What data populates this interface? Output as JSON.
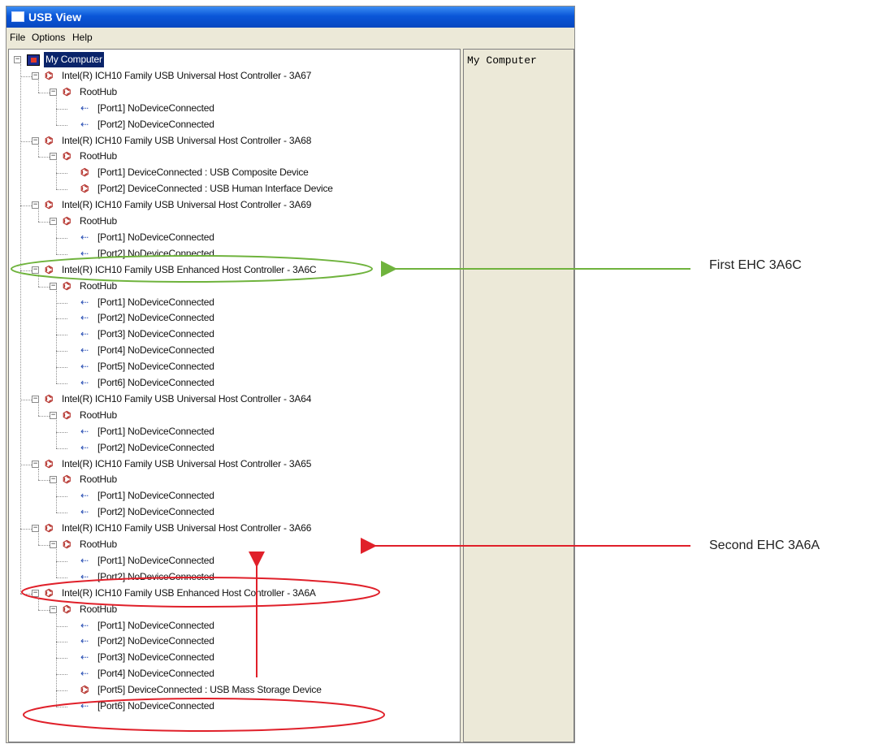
{
  "window": {
    "title": "USB View"
  },
  "menu": [
    "File",
    "Options",
    "Help"
  ],
  "detail": {
    "text": "My Computer"
  },
  "colors": {
    "accent_green": "#6fb33d",
    "accent_red": "#e0202a",
    "selection": "#0a246a"
  },
  "tree": [
    {
      "level": 0,
      "label": "My Computer",
      "icon": "computer-icon",
      "exp": "minus",
      "selected": true
    },
    {
      "level": 1,
      "label": "Intel(R) ICH10 Family USB Universal Host Controller - 3A67",
      "icon": "usb-controller-icon",
      "exp": "minus"
    },
    {
      "level": 2,
      "label": "RootHub",
      "icon": "usb-hub-icon",
      "exp": "minus"
    },
    {
      "level": 3,
      "label": "[Port1] NoDeviceConnected",
      "icon": "usb-port-icon"
    },
    {
      "level": 3,
      "label": "[Port2] NoDeviceConnected",
      "icon": "usb-port-icon"
    },
    {
      "level": 1,
      "label": "Intel(R) ICH10 Family USB Universal Host Controller - 3A68",
      "icon": "usb-controller-icon",
      "exp": "minus"
    },
    {
      "level": 2,
      "label": "RootHub",
      "icon": "usb-hub-icon",
      "exp": "minus"
    },
    {
      "level": 3,
      "label": "[Port1] DeviceConnected :  USB Composite Device",
      "icon": "usb-device-icon"
    },
    {
      "level": 3,
      "label": "[Port2] DeviceConnected :  USB Human Interface Device",
      "icon": "usb-device-icon"
    },
    {
      "level": 1,
      "label": "Intel(R) ICH10 Family USB Universal Host Controller - 3A69",
      "icon": "usb-controller-icon",
      "exp": "minus"
    },
    {
      "level": 2,
      "label": "RootHub",
      "icon": "usb-hub-icon",
      "exp": "minus"
    },
    {
      "level": 3,
      "label": "[Port1] NoDeviceConnected",
      "icon": "usb-port-icon"
    },
    {
      "level": 3,
      "label": "[Port2] NoDeviceConnected",
      "icon": "usb-port-icon"
    },
    {
      "level": 1,
      "label": "Intel(R) ICH10 Family USB Enhanced Host Controller - 3A6C",
      "icon": "usb-controller-icon",
      "exp": "minus"
    },
    {
      "level": 2,
      "label": "RootHub",
      "icon": "usb-hub-icon",
      "exp": "minus"
    },
    {
      "level": 3,
      "label": "[Port1] NoDeviceConnected",
      "icon": "usb-port-icon"
    },
    {
      "level": 3,
      "label": "[Port2] NoDeviceConnected",
      "icon": "usb-port-icon"
    },
    {
      "level": 3,
      "label": "[Port3] NoDeviceConnected",
      "icon": "usb-port-icon"
    },
    {
      "level": 3,
      "label": "[Port4] NoDeviceConnected",
      "icon": "usb-port-icon"
    },
    {
      "level": 3,
      "label": "[Port5] NoDeviceConnected",
      "icon": "usb-port-icon"
    },
    {
      "level": 3,
      "label": "[Port6] NoDeviceConnected",
      "icon": "usb-port-icon"
    },
    {
      "level": 1,
      "label": "Intel(R) ICH10 Family USB Universal Host Controller - 3A64",
      "icon": "usb-controller-icon",
      "exp": "minus"
    },
    {
      "level": 2,
      "label": "RootHub",
      "icon": "usb-hub-icon",
      "exp": "minus"
    },
    {
      "level": 3,
      "label": "[Port1] NoDeviceConnected",
      "icon": "usb-port-icon"
    },
    {
      "level": 3,
      "label": "[Port2] NoDeviceConnected",
      "icon": "usb-port-icon"
    },
    {
      "level": 1,
      "label": "Intel(R) ICH10 Family USB Universal Host Controller - 3A65",
      "icon": "usb-controller-icon",
      "exp": "minus"
    },
    {
      "level": 2,
      "label": "RootHub",
      "icon": "usb-hub-icon",
      "exp": "minus"
    },
    {
      "level": 3,
      "label": "[Port1] NoDeviceConnected",
      "icon": "usb-port-icon"
    },
    {
      "level": 3,
      "label": "[Port2] NoDeviceConnected",
      "icon": "usb-port-icon"
    },
    {
      "level": 1,
      "label": "Intel(R) ICH10 Family USB Universal Host Controller - 3A66",
      "icon": "usb-controller-icon",
      "exp": "minus"
    },
    {
      "level": 2,
      "label": "RootHub",
      "icon": "usb-hub-icon",
      "exp": "minus"
    },
    {
      "level": 3,
      "label": "[Port1] NoDeviceConnected",
      "icon": "usb-port-icon"
    },
    {
      "level": 3,
      "label": "[Port2] NoDeviceConnected",
      "icon": "usb-port-icon"
    },
    {
      "level": 1,
      "label": "Intel(R) ICH10 Family USB Enhanced Host Controller - 3A6A",
      "icon": "usb-controller-icon",
      "exp": "minus"
    },
    {
      "level": 2,
      "label": "RootHub",
      "icon": "usb-hub-icon",
      "exp": "minus"
    },
    {
      "level": 3,
      "label": "[Port1] NoDeviceConnected",
      "icon": "usb-port-icon"
    },
    {
      "level": 3,
      "label": "[Port2] NoDeviceConnected",
      "icon": "usb-port-icon"
    },
    {
      "level": 3,
      "label": "[Port3] NoDeviceConnected",
      "icon": "usb-port-icon"
    },
    {
      "level": 3,
      "label": "[Port4] NoDeviceConnected",
      "icon": "usb-port-icon"
    },
    {
      "level": 3,
      "label": "[Port5] DeviceConnected :  USB Mass Storage Device",
      "icon": "usb-device-icon"
    },
    {
      "level": 3,
      "label": "[Port6] NoDeviceConnected",
      "icon": "usb-port-icon"
    }
  ],
  "annotations": [
    {
      "text": "First EHC 3A6C",
      "color": "green"
    },
    {
      "text": "Second EHC 3A6A",
      "color": "red"
    }
  ]
}
